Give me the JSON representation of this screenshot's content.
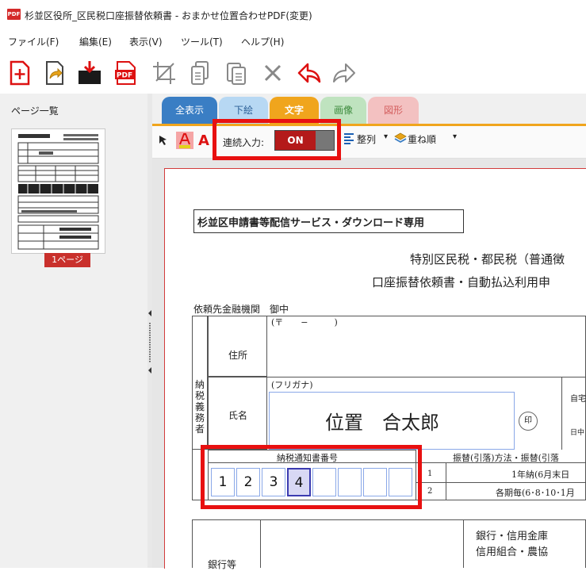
{
  "window": {
    "app_icon": "PDF",
    "title": "杉並区役所_区民税口座振替依頼書 - おまかせ位置合わせPDF(変更)"
  },
  "menu": [
    "ファイル(F)",
    "編集(E)",
    "表示(V)",
    "ツール(T)",
    "ヘルプ(H)"
  ],
  "toolbar_icons": [
    "add-file-icon",
    "share-icon",
    "import-icon",
    "pdf-icon",
    "crop-icon",
    "copy-icon",
    "paste-icon",
    "delete-icon",
    "undo-icon",
    "redo-icon"
  ],
  "sidebar": {
    "title": "ページ一覧",
    "page_label": "1ページ"
  },
  "tabs": [
    {
      "label": "全表示",
      "color": "#3a7ec4"
    },
    {
      "label": "下絵",
      "color": "#b7d8f3"
    },
    {
      "label": "文字",
      "color": "#f0a51d"
    },
    {
      "label": "画像",
      "color": "#bfe3bf"
    },
    {
      "label": "図形",
      "color": "#f3c1c1"
    }
  ],
  "options": {
    "font_color_mark": "A",
    "continuous_label": "連続入力:",
    "toggle": "ON",
    "align_label": "整列",
    "order_label": "重ね順"
  },
  "document": {
    "header_box": "杉並区申請書等配信サービス・ダウンロード専用",
    "title_line1": "特別区民税・都民税（普通徴",
    "title_line2": "口座振替依頼書・自動払込利用申",
    "recipient": "依頼先金融機関　御中",
    "taxpayer_label": "納税義務者",
    "postal": "(〒　　−　　　)",
    "address_label": "住所",
    "furigana_label": "(フリガナ)",
    "name_label": "氏名",
    "name_value": "位置　合太郎",
    "seal": "印",
    "right_partial_1": "自宅",
    "right_partial_2": "日中",
    "notice_label": "納税通知書番号",
    "notice_digits": [
      "1",
      "2",
      "3",
      "4",
      "",
      "",
      "",
      ""
    ],
    "method_header": "振替(引落)方法・振替(引落",
    "row1_num": "1",
    "row1_text": "1年納(6月末日",
    "row2_num": "2",
    "row2_text": "各期毎(6･8･10･1月",
    "bank_types_1": "銀行・信用金庫",
    "bank_types_2": "信用組合・農協",
    "bank_label_partial": "銀行等"
  }
}
